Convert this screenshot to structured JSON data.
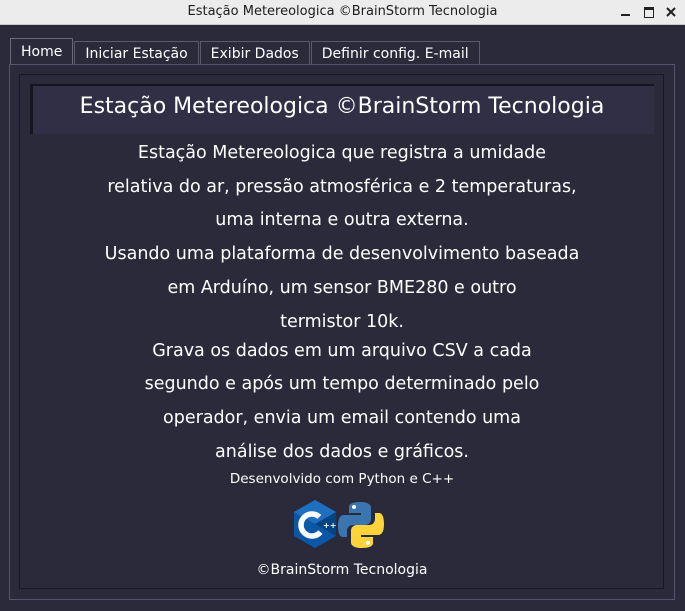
{
  "window": {
    "title": "Estação Metereologica ©BrainStorm Tecnologia",
    "controls": [
      "minimize-icon",
      "maximize-icon",
      "close-icon"
    ]
  },
  "tabs": [
    {
      "label": "Home",
      "active": true
    },
    {
      "label": "Iniciar Estação",
      "active": false
    },
    {
      "label": "Exibir Dados",
      "active": false
    },
    {
      "label": "Definir config. E-mail",
      "active": false
    }
  ],
  "home": {
    "heading": "Estação Metereologica ©BrainStorm Tecnologia",
    "description_lines": [
      "Estação Metereologica que registra a umidade",
      "relativa do ar, pressão atmosférica e 2 temperaturas,",
      "uma interna e outra externa.",
      "Usando uma plataforma de desenvolvimento baseada",
      "em Arduíno, um sensor BME280 e outro",
      "termistor 10k.",
      "Grava os dados em um arquivo CSV a cada",
      "segundo e após um tempo determinado pelo",
      "operador, envia um email contendo uma",
      "análise dos dados e gráficos."
    ],
    "developed_with": "Desenvolvido com Python e C++",
    "logos": [
      "cpp-logo",
      "python-logo"
    ],
    "copyright": "©BrainStorm Tecnologia"
  },
  "colors": {
    "background": "#2b2a3b",
    "text": "#ffffff",
    "cpp_blue": "#0a57a8",
    "python_blue": "#3b75b0",
    "python_yellow": "#ffd43b"
  }
}
